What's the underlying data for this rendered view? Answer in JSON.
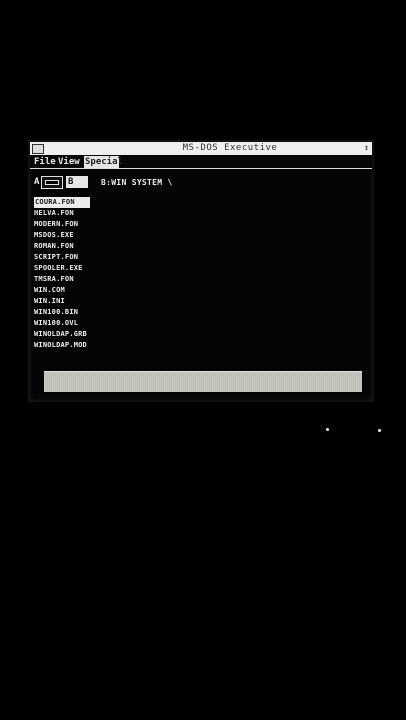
{
  "window": {
    "title": "MS-DOS Executive",
    "size_box_glyph": "↕"
  },
  "menubar": {
    "items": [
      {
        "label": "File"
      },
      {
        "label": "View"
      },
      {
        "label": "Special"
      }
    ]
  },
  "drives": {
    "a_label": "A",
    "b_label": "B",
    "current_path": "B:WIN SYSTEM \\"
  },
  "files": [
    {
      "name": "COURA.FON",
      "selected": true
    },
    {
      "name": "HELVA.FON"
    },
    {
      "name": "MODERN.FON"
    },
    {
      "name": "MSDOS.EXE"
    },
    {
      "name": "ROMAN.FON"
    },
    {
      "name": "SCRIPT.FON"
    },
    {
      "name": "SPOOLER.EXE"
    },
    {
      "name": "TMSRA.FON"
    },
    {
      "name": "WIN.COM"
    },
    {
      "name": "WIN.INI"
    },
    {
      "name": "WIN100.BIN"
    },
    {
      "name": "WIN100.OVL"
    },
    {
      "name": "WINOLDAP.GRB"
    },
    {
      "name": "WINOLDAP.MOD"
    }
  ]
}
